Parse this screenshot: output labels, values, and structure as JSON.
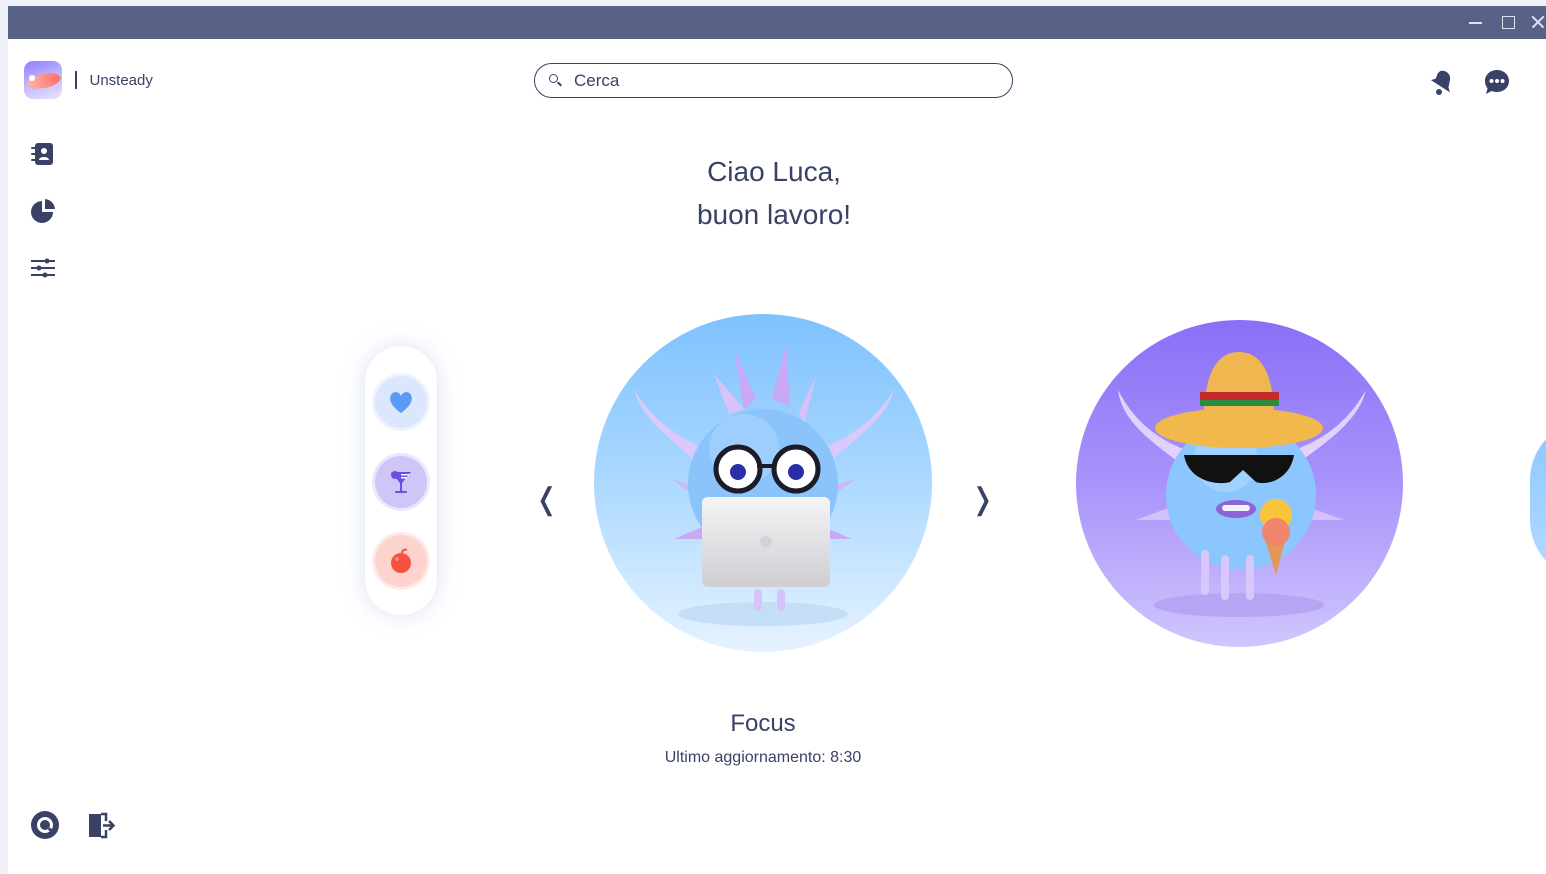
{
  "window": {
    "minimize_icon": "minimize-icon",
    "maximize_icon": "maximize-icon",
    "close_icon": "close-icon"
  },
  "brand": {
    "name": "Unsteady"
  },
  "search": {
    "placeholder": "Cerca",
    "value": ""
  },
  "header_icons": [
    "bell-icon",
    "chat-icon"
  ],
  "sidebar": {
    "items": [
      {
        "icon": "contacts-icon"
      },
      {
        "icon": "pie-chart-icon"
      },
      {
        "icon": "sliders-icon"
      }
    ],
    "bottom": [
      {
        "icon": "help-icon"
      },
      {
        "icon": "logout-icon"
      }
    ]
  },
  "greeting": {
    "line1": "Ciao Luca,",
    "line2": "buon lavoro!"
  },
  "mood_bar": {
    "items": [
      {
        "icon": "heart-icon"
      },
      {
        "icon": "drink-icon"
      },
      {
        "icon": "bomb-icon"
      }
    ]
  },
  "carousel": {
    "prev_label": "❬",
    "next_label": "❭",
    "current": {
      "title": "Focus",
      "updated": "Ultimo aggiornamento: 8:30"
    }
  },
  "colors": {
    "titlebar": "#586186",
    "text": "#3a4166",
    "focus_avatar": "#7ec2ff",
    "relax_avatar": "#8a6ff7"
  }
}
